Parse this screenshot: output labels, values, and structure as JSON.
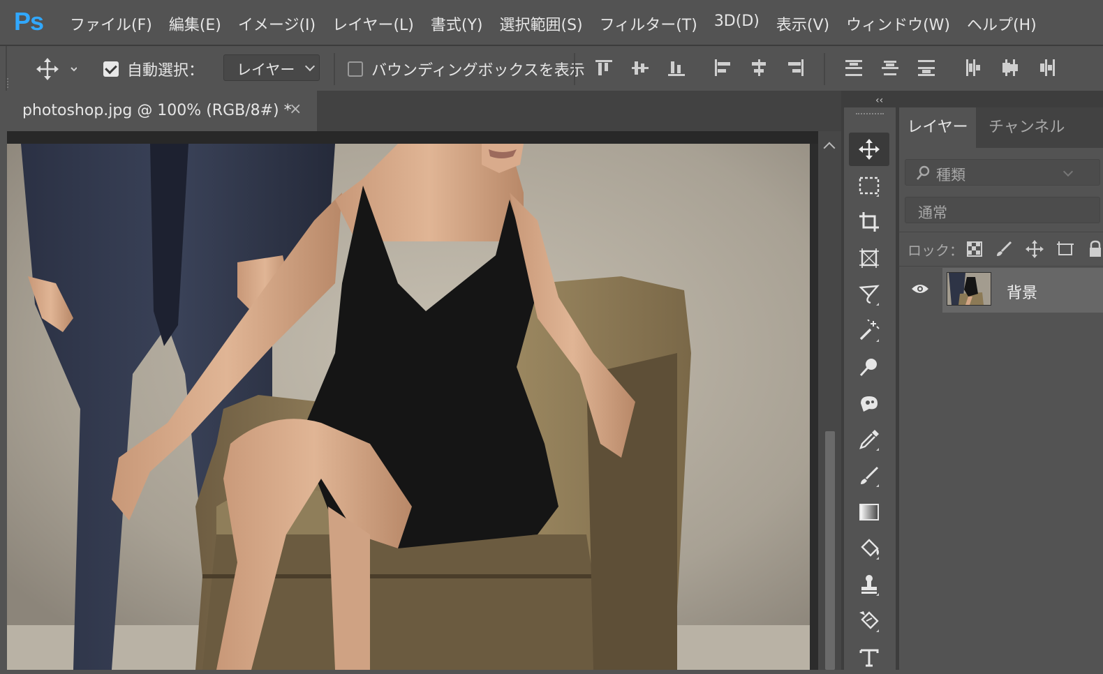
{
  "app": {
    "logo": "Ps"
  },
  "menu": [
    "ファイル(F)",
    "編集(E)",
    "イメージ(I)",
    "レイヤー(L)",
    "書式(Y)",
    "選択範囲(S)",
    "フィルター(T)",
    "3D(D)",
    "表示(V)",
    "ウィンドウ(W)",
    "ヘルプ(H)"
  ],
  "options": {
    "auto_select_label": "自動選択：",
    "auto_select_checked": true,
    "target_value": "レイヤー",
    "bounding_box_label": "バウンディングボックスを表示",
    "bounding_box_checked": false
  },
  "document": {
    "tab_title": "photoshop.jpg @ 100% (RGB/8#) *",
    "close": "×"
  },
  "panel": {
    "collapse": "‹‹",
    "tabs": [
      "レイヤー",
      "チャンネル"
    ],
    "kind_placeholder": "種類",
    "blend_mode": "通常",
    "lock_label": "ロック：",
    "layers": [
      {
        "name": "背景",
        "visible": true
      }
    ]
  },
  "tools": [
    "move-tool",
    "marquee-tool",
    "crop-tool",
    "frame-tool",
    "lasso-tool",
    "magic-wand-tool",
    "quick-selection-tool",
    "patch-tool",
    "eyedropper-tool",
    "brush-tool",
    "gradient-tool",
    "paint-bucket-tool",
    "stamp-tool",
    "eraser-bucket-tool",
    "type-tool"
  ],
  "colors": {
    "accent": "#31a8ff",
    "ui_bg": "#535353",
    "dark": "#424242"
  }
}
